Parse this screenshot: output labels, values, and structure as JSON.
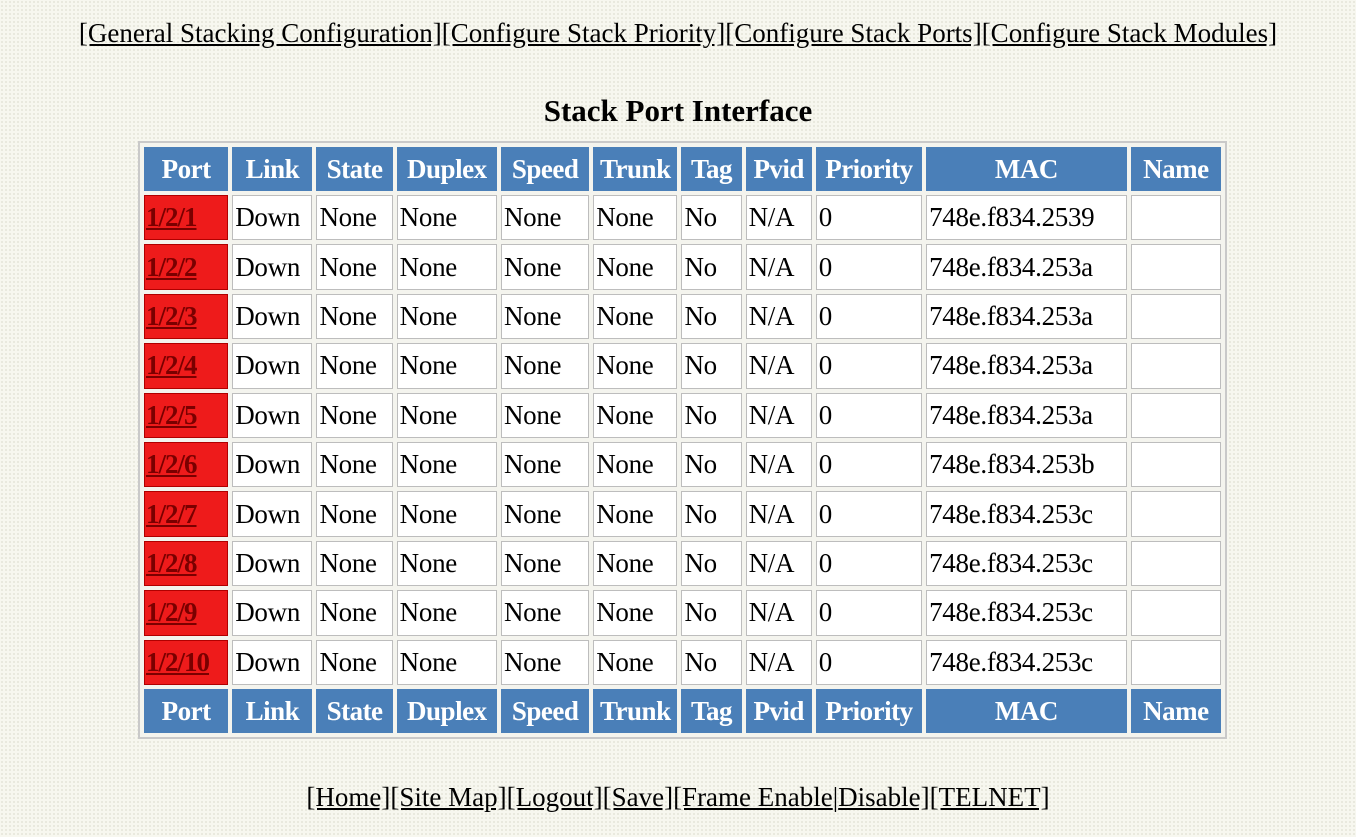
{
  "top_nav": [
    "[General Stacking Configuration]",
    "[Configure Stack Priority]",
    "[Configure Stack Ports]",
    "[Configure Stack Modules]"
  ],
  "title": "Stack Port Interface",
  "table": {
    "columns": [
      "Port",
      "Link",
      "State",
      "Duplex",
      "Speed",
      "Trunk",
      "Tag",
      "Pvid",
      "Priority",
      "MAC",
      "Name"
    ],
    "rows": [
      [
        "1/2/1",
        "Down",
        "None",
        "None",
        "None",
        "None",
        "No",
        "N/A",
        "0",
        "748e.f834.2539",
        ""
      ],
      [
        "1/2/2",
        "Down",
        "None",
        "None",
        "None",
        "None",
        "No",
        "N/A",
        "0",
        "748e.f834.253a",
        ""
      ],
      [
        "1/2/3",
        "Down",
        "None",
        "None",
        "None",
        "None",
        "No",
        "N/A",
        "0",
        "748e.f834.253a",
        ""
      ],
      [
        "1/2/4",
        "Down",
        "None",
        "None",
        "None",
        "None",
        "No",
        "N/A",
        "0",
        "748e.f834.253a",
        ""
      ],
      [
        "1/2/5",
        "Down",
        "None",
        "None",
        "None",
        "None",
        "No",
        "N/A",
        "0",
        "748e.f834.253a",
        ""
      ],
      [
        "1/2/6",
        "Down",
        "None",
        "None",
        "None",
        "None",
        "No",
        "N/A",
        "0",
        "748e.f834.253b",
        ""
      ],
      [
        "1/2/7",
        "Down",
        "None",
        "None",
        "None",
        "None",
        "No",
        "N/A",
        "0",
        "748e.f834.253c",
        ""
      ],
      [
        "1/2/8",
        "Down",
        "None",
        "None",
        "None",
        "None",
        "No",
        "N/A",
        "0",
        "748e.f834.253c",
        ""
      ],
      [
        "1/2/9",
        "Down",
        "None",
        "None",
        "None",
        "None",
        "No",
        "N/A",
        "0",
        "748e.f834.253c",
        ""
      ],
      [
        "1/2/10",
        "Down",
        "None",
        "None",
        "None",
        "None",
        "No",
        "N/A",
        "0",
        "748e.f834.253c",
        ""
      ]
    ]
  },
  "bottom_nav": {
    "home": "[Home]",
    "site_map": "[Site Map]",
    "logout": "[Logout]",
    "save": "[Save]",
    "frame_enable": "[Frame Enable",
    "separator": "|",
    "disable": "Disable]",
    "telnet": "[TELNET]"
  },
  "colors": {
    "header_bg": "#4a7fb8",
    "port_cell_bg": "#ee1b1b",
    "port_link": "#7a0000",
    "page_bg": "#f7f7ef"
  }
}
